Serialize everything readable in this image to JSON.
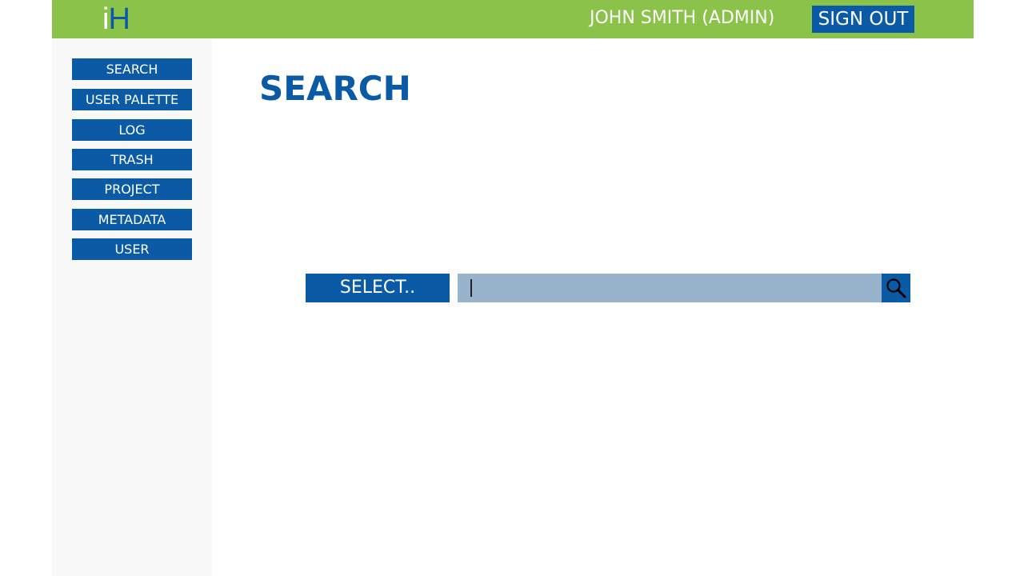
{
  "header": {
    "logo_i": "i",
    "logo_h": "H",
    "user": "JOHN SMITH (ADMIN)",
    "signout": "SIGN OUT"
  },
  "sidebar": {
    "items": [
      {
        "label": "SEARCH"
      },
      {
        "label": "USER PALETTE"
      },
      {
        "label": "LOG"
      },
      {
        "label": "TRASH"
      },
      {
        "label": "PROJECT"
      },
      {
        "label": "METADATA"
      },
      {
        "label": "USER"
      }
    ]
  },
  "main": {
    "title": "SEARCH",
    "select_label": "SELECT..",
    "search_value": "",
    "search_icon": "search-icon"
  },
  "colors": {
    "header_bg": "#8bc34a",
    "accent": "#0b5aa5",
    "search_field_bg": "#97b4cc",
    "sidebar_bg": "#f8f8f8"
  }
}
